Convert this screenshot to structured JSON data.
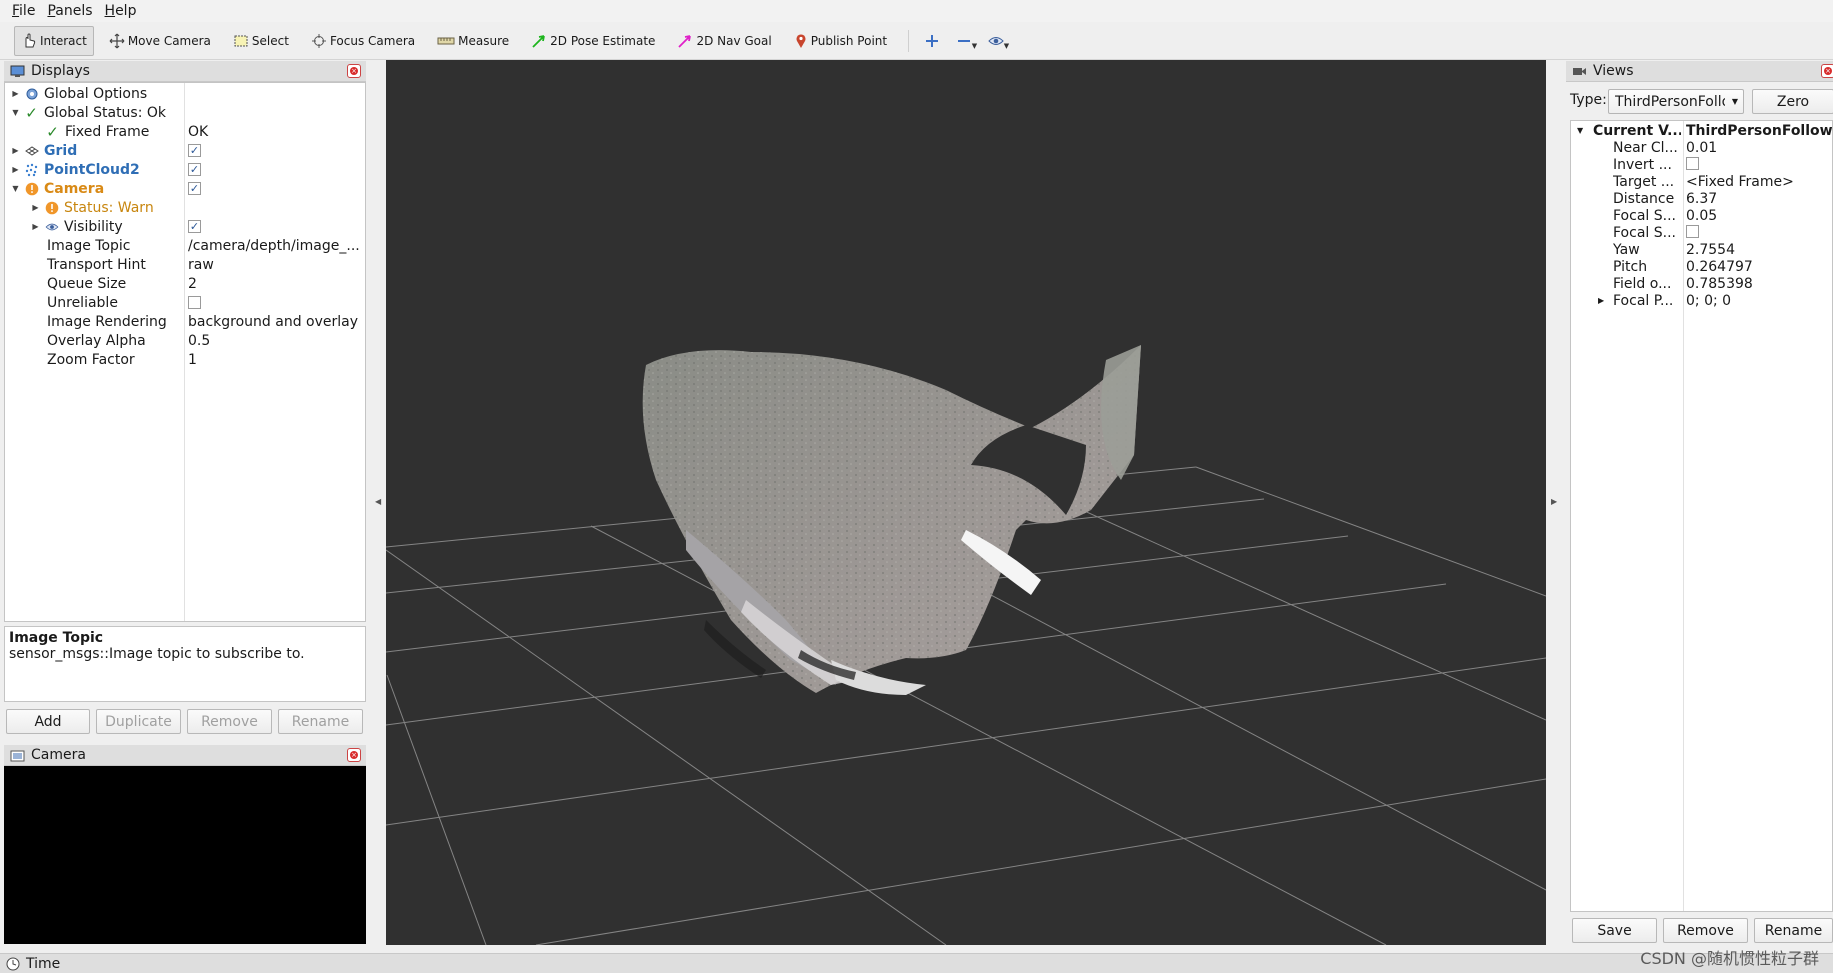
{
  "menubar": {
    "items": [
      "File",
      "Panels",
      "Help"
    ]
  },
  "toolbar": {
    "tools": [
      {
        "label": "Interact",
        "icon": "hand-pointer-icon",
        "active": true
      },
      {
        "label": "Move Camera",
        "icon": "move-arrows-icon"
      },
      {
        "label": "Select",
        "icon": "select-rectangle-icon"
      },
      {
        "label": "Focus Camera",
        "icon": "focus-target-icon"
      },
      {
        "label": "Measure",
        "icon": "ruler-icon"
      },
      {
        "label": "2D Pose Estimate",
        "icon": "green-arrow-icon"
      },
      {
        "label": "2D Nav Goal",
        "icon": "magenta-arrow-icon"
      },
      {
        "label": "Publish Point",
        "icon": "map-pin-icon"
      }
    ]
  },
  "displays": {
    "title": "Displays",
    "tree": [
      {
        "name": "Global Options"
      },
      {
        "name": "Global Status: Ok"
      },
      {
        "name": "Fixed Frame",
        "value": "OK"
      },
      {
        "name": "Grid",
        "checked": true
      },
      {
        "name": "PointCloud2",
        "checked": true
      },
      {
        "name": "Camera",
        "checked": true
      },
      {
        "name": "Status: Warn"
      },
      {
        "name": "Visibility",
        "checked": true
      },
      {
        "name": "Image Topic",
        "value": "/camera/depth/image_..."
      },
      {
        "name": "Transport Hint",
        "value": "raw"
      },
      {
        "name": "Queue Size",
        "value": "2"
      },
      {
        "name": "Unreliable",
        "checked": false
      },
      {
        "name": "Image Rendering",
        "value": "background and overlay"
      },
      {
        "name": "Overlay Alpha",
        "value": "0.5"
      },
      {
        "name": "Zoom Factor",
        "value": "1"
      }
    ],
    "help": {
      "title": "Image Topic",
      "text": "sensor_msgs::Image topic to subscribe to."
    },
    "buttons": [
      "Add",
      "Duplicate",
      "Remove",
      "Rename"
    ]
  },
  "camera_panel": {
    "title": "Camera"
  },
  "views": {
    "title": "Views",
    "type_label": "Type:",
    "type_value": "ThirdPersonFollower",
    "zero_label": "Zero",
    "header": {
      "name": "Current V...",
      "value": "ThirdPersonFollow..."
    },
    "rows": [
      {
        "name": "Near Cl...",
        "value": "0.01"
      },
      {
        "name": "Invert ...",
        "checked": false
      },
      {
        "name": "Target ...",
        "value": "<Fixed Frame>"
      },
      {
        "name": "Distance",
        "value": "6.37"
      },
      {
        "name": "Focal S...",
        "value": "0.05"
      },
      {
        "name": "Focal S...",
        "checked": false
      },
      {
        "name": "Yaw",
        "value": "2.7554"
      },
      {
        "name": "Pitch",
        "value": "0.264797"
      },
      {
        "name": "Field o...",
        "value": "0.785398"
      },
      {
        "name": "Focal P...",
        "value": "0; 0; 0"
      }
    ],
    "buttons": [
      "Save",
      "Remove",
      "Rename"
    ]
  },
  "time_bar": {
    "title": "Time"
  },
  "watermark": "CSDN @随机惯性粒子群"
}
